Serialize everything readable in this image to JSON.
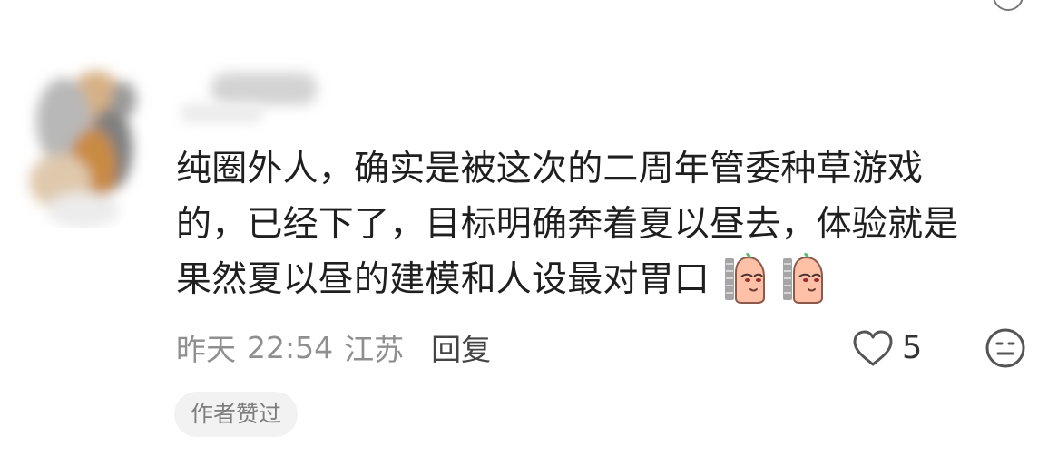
{
  "comment": {
    "lines": [
      "纯圈外人，确实是被这次的二周年管委种草游戏",
      "的，已经下了，目标明确奔着夏以昼去，体验就是",
      "果然夏以昼的建模和人设最对胃口"
    ],
    "stickers": [
      "peek-sticker",
      "peek-sticker"
    ]
  },
  "meta": {
    "date": "昨天",
    "time": "22:54",
    "location": "江苏",
    "reply_label": "回复"
  },
  "likes": {
    "count": "5",
    "icon": "heart-outline-icon"
  },
  "emoji_button": {
    "icon": "emoji-icon"
  },
  "author_badge": {
    "label": "作者赞过"
  },
  "colors": {
    "text_primary": "#1f1f1f",
    "text_secondary": "#8f8f8f",
    "badge_bg": "#f2f2f2"
  }
}
